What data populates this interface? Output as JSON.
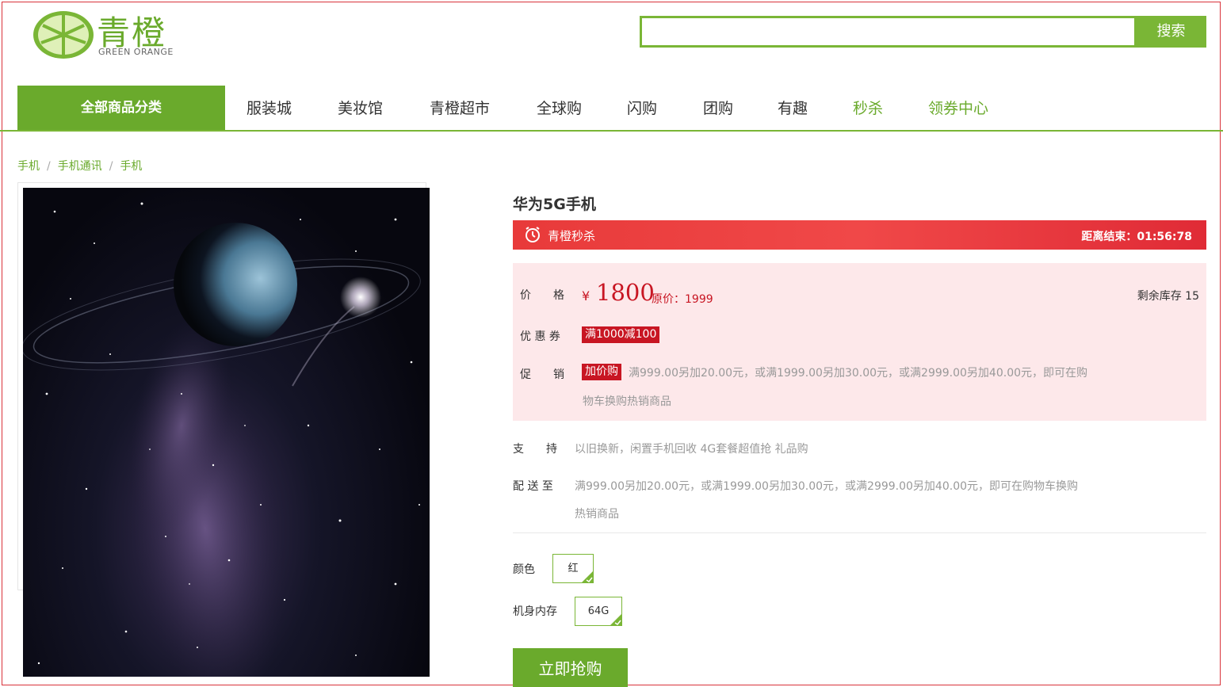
{
  "brand": {
    "name": "青橙",
    "subtitle": "GREEN ORANGE",
    "logo_icon": "orange-slice-icon",
    "accent_color": "#6aaa2c"
  },
  "search": {
    "value": "",
    "placeholder": "",
    "button_label": "搜索"
  },
  "nav": {
    "category_label": "全部商品分类",
    "items": [
      {
        "label": "服装城"
      },
      {
        "label": "美妆馆"
      },
      {
        "label": "青橙超市"
      },
      {
        "label": "全球购"
      },
      {
        "label": "闪购"
      },
      {
        "label": "团购"
      },
      {
        "label": "有趣"
      },
      {
        "label": "秒杀"
      },
      {
        "label": "领券中心"
      }
    ]
  },
  "breadcrumb": [
    "手机",
    "手机通讯",
    "手机"
  ],
  "product": {
    "title": "华为5G手机",
    "image_icon": "space-planet-image"
  },
  "flash_sale": {
    "label": "青橙秒杀",
    "timer_label": "距离结束：",
    "timer_value": "01:56:78",
    "icon": "alarm-clock-icon",
    "color": "#e83a3a"
  },
  "pricing": {
    "price_label": "价　　格",
    "currency": "¥",
    "price": "1800",
    "original": "原价：1999",
    "stock": "剩余库存 15",
    "coupon_label": "优 惠 券",
    "coupon_tag": "满1000减100",
    "promo_label": "促　　销",
    "promo_tag": "加价购",
    "promo_line1": "满999.00另加20.00元，或满1999.00另加30.00元，或满2999.00另加40.00元，即可在购",
    "promo_line2": "物车换购热销商品"
  },
  "support": {
    "label": "支　　持",
    "value": "以旧换新，闲置手机回收 4G套餐超值抢 礼品购"
  },
  "delivery": {
    "label": "配 送 至",
    "line1": "满999.00另加20.00元，或满1999.00另加30.00元，或满2999.00另加40.00元，即可在购物车换购",
    "line2": "热销商品"
  },
  "options": {
    "color_label": "颜色",
    "color_value": "红",
    "memory_label": "机身内存",
    "memory_value": "64G"
  },
  "buy_button": "立即抢购"
}
